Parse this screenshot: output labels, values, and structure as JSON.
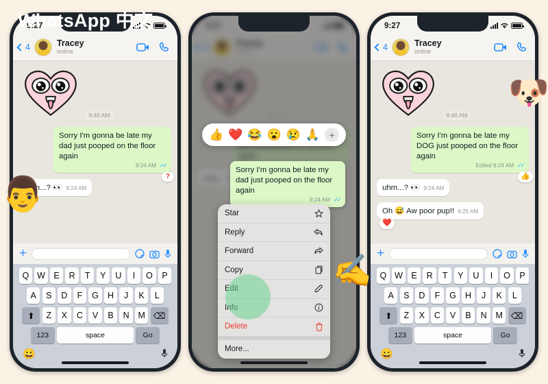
{
  "watermark": "WhatsApp 中文",
  "colors": {
    "background": "#fbf2e6",
    "accent_blue": "#1f8bff",
    "outgoing_bubble": "#dcf8c6",
    "incoming_bubble": "#ffffff",
    "danger_red": "#ec3b2e",
    "highlight_green": "#6ad692"
  },
  "status_bar": {
    "time": "9:27"
  },
  "header": {
    "back_count": "4",
    "contact_name": "Tracey",
    "presence": "online",
    "video_icon": "video-call-icon",
    "call_icon": "voice-call-icon",
    "back_icon": "back-chevron-icon",
    "avatar": "contact-avatar"
  },
  "phone1": {
    "sticker": "pink-heart-face-sticker",
    "sticker_time": "8:46 AM",
    "messages": [
      {
        "direction": "out",
        "text": "Sorry I'm gonna be late my dad just pooped on the floor again",
        "time": "9:24 AM",
        "ticks": "read-ticks-icon",
        "reaction": "?"
      },
      {
        "direction": "in",
        "text": "uhm...? 👀",
        "time": "9:24 AM"
      }
    ]
  },
  "phone2": {
    "emoji_reactions": [
      "👍",
      "❤️",
      "😂",
      "😮",
      "😢",
      "🙏"
    ],
    "emoji_add_label": "+",
    "focused_message": {
      "text": "Sorry I'm gonna be late my dad just pooped on the floor again",
      "time": "9:24 AM"
    },
    "context_menu": [
      {
        "label": "Star",
        "icon": "star-icon"
      },
      {
        "label": "Reply",
        "icon": "reply-arrow-icon"
      },
      {
        "label": "Forward",
        "icon": "forward-arrow-icon"
      },
      {
        "label": "Copy",
        "icon": "copy-icon"
      },
      {
        "label": "Edit",
        "icon": "pencil-icon",
        "highlighted": true
      },
      {
        "label": "Info",
        "icon": "info-circle-icon"
      },
      {
        "label": "Delete",
        "icon": "trash-icon",
        "danger": true
      },
      {
        "label": "More...",
        "icon": ""
      }
    ],
    "pointer": "writing-hand-cursor"
  },
  "phone3": {
    "sticker": "pink-heart-face-sticker",
    "sticker_time": "8:46 AM",
    "messages": [
      {
        "direction": "out",
        "text": "Sorry I'm gonna be late my DOG just pooped on the floor again",
        "time": "Edited 9:24 AM",
        "ticks": "read-ticks-icon",
        "reaction": "👍"
      },
      {
        "direction": "in",
        "text": "uhm...? 👀",
        "time": "9:24 AM"
      },
      {
        "direction": "in",
        "text": "Oh 😅 Aw poor pup!!",
        "time": "9:25 AM",
        "reaction": "❤️"
      }
    ]
  },
  "keyboard": {
    "row1": [
      "Q",
      "W",
      "E",
      "R",
      "T",
      "Y",
      "U",
      "I",
      "O",
      "P"
    ],
    "row2": [
      "A",
      "S",
      "D",
      "F",
      "G",
      "H",
      "J",
      "K",
      "L"
    ],
    "row3": [
      "Z",
      "X",
      "C",
      "V",
      "B",
      "N",
      "M"
    ],
    "shift_label": "⬆",
    "backspace_label": "⌫",
    "numbers_label": "123",
    "space_label": "space",
    "go_label": "Go",
    "emoji_label": "😀",
    "mic_label": "mic-icon"
  },
  "input_bar": {
    "plus_label": "+",
    "value": "",
    "placeholder": "",
    "sticker_icon": "sticker-icon",
    "camera_icon": "camera-icon",
    "mic_icon": "microphone-icon"
  },
  "stickers": {
    "man_face": "👨",
    "dog_face": "🐶"
  }
}
